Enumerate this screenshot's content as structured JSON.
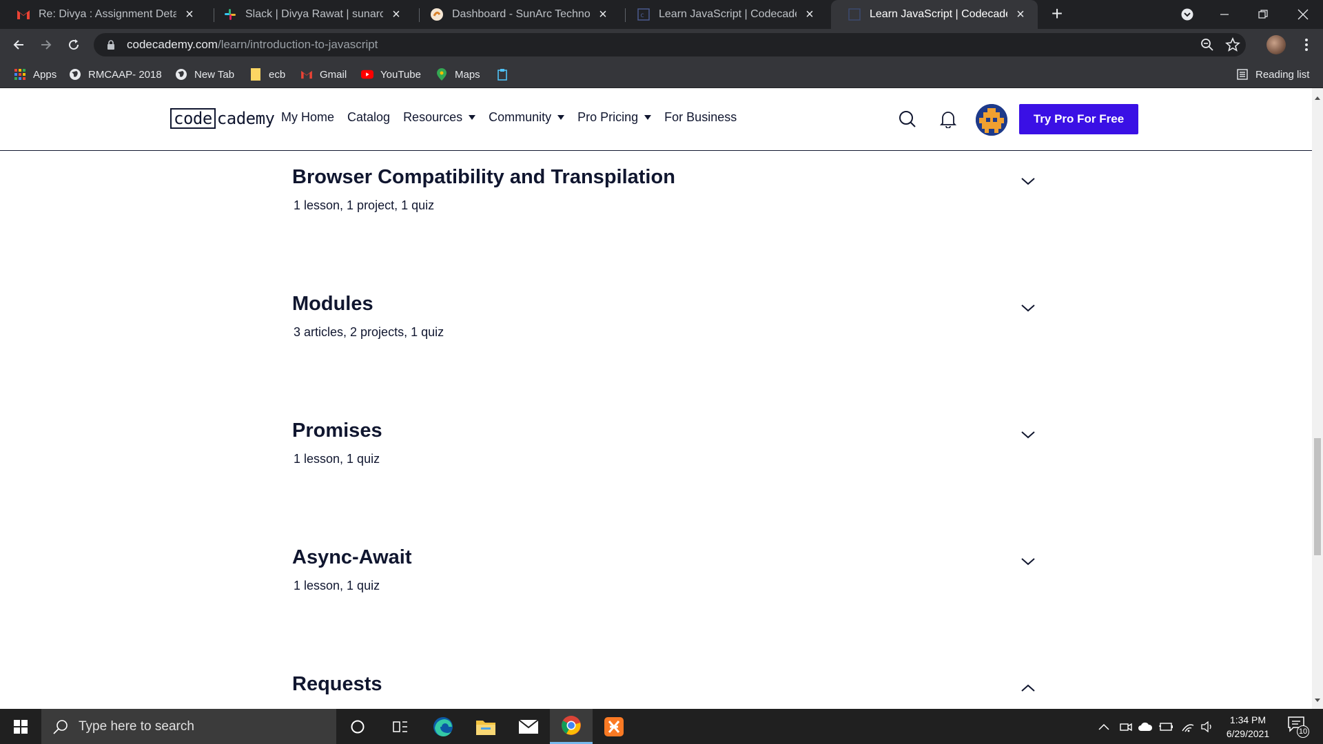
{
  "browser": {
    "tabs": [
      {
        "title": "Re: Divya : Assignment Details &",
        "icon": "gmail-icon",
        "active": false
      },
      {
        "title": "Slack | Divya Rawat | sunarc",
        "icon": "slack-icon",
        "active": false
      },
      {
        "title": "Dashboard - SunArc Technologies",
        "icon": "sunarc-icon",
        "active": false
      },
      {
        "title": "Learn JavaScript | Codecademy",
        "icon": "codecademy-icon",
        "active": false
      },
      {
        "title": "Learn JavaScript | Codecademy",
        "icon": "codecademy-icon",
        "active": true
      }
    ],
    "url_host": "codecademy.com",
    "url_path": "/learn/introduction-to-javascript",
    "bookmarks": [
      "Apps",
      "RMCAAP- 2018",
      "New Tab",
      "ecb",
      "Gmail",
      "YouTube",
      "Maps"
    ],
    "reading_list": "Reading list"
  },
  "site": {
    "logo_boxed": "code",
    "logo_rest": "cademy",
    "nav": [
      "My Home",
      "Catalog",
      "Resources",
      "Community",
      "Pro Pricing",
      "For Business"
    ],
    "cta": "Try Pro For Free",
    "accent": "#3a10e5",
    "text_color": "#10162f"
  },
  "modules": [
    {
      "title": "Browser Compatibility and Transpilation",
      "meta": "1 lesson, 1 project, 1 quiz",
      "expanded": false
    },
    {
      "title": "Modules",
      "meta": "3 articles, 2 projects, 1 quiz",
      "expanded": false
    },
    {
      "title": "Promises",
      "meta": "1 lesson, 1 quiz",
      "expanded": false
    },
    {
      "title": "Async-Await",
      "meta": "1 lesson, 1 quiz",
      "expanded": false
    },
    {
      "title": "Requests",
      "meta": "",
      "expanded": true
    }
  ],
  "taskbar": {
    "search_placeholder": "Type here to search",
    "time": "1:34 PM",
    "date": "6/29/2021",
    "notifications": "10"
  }
}
